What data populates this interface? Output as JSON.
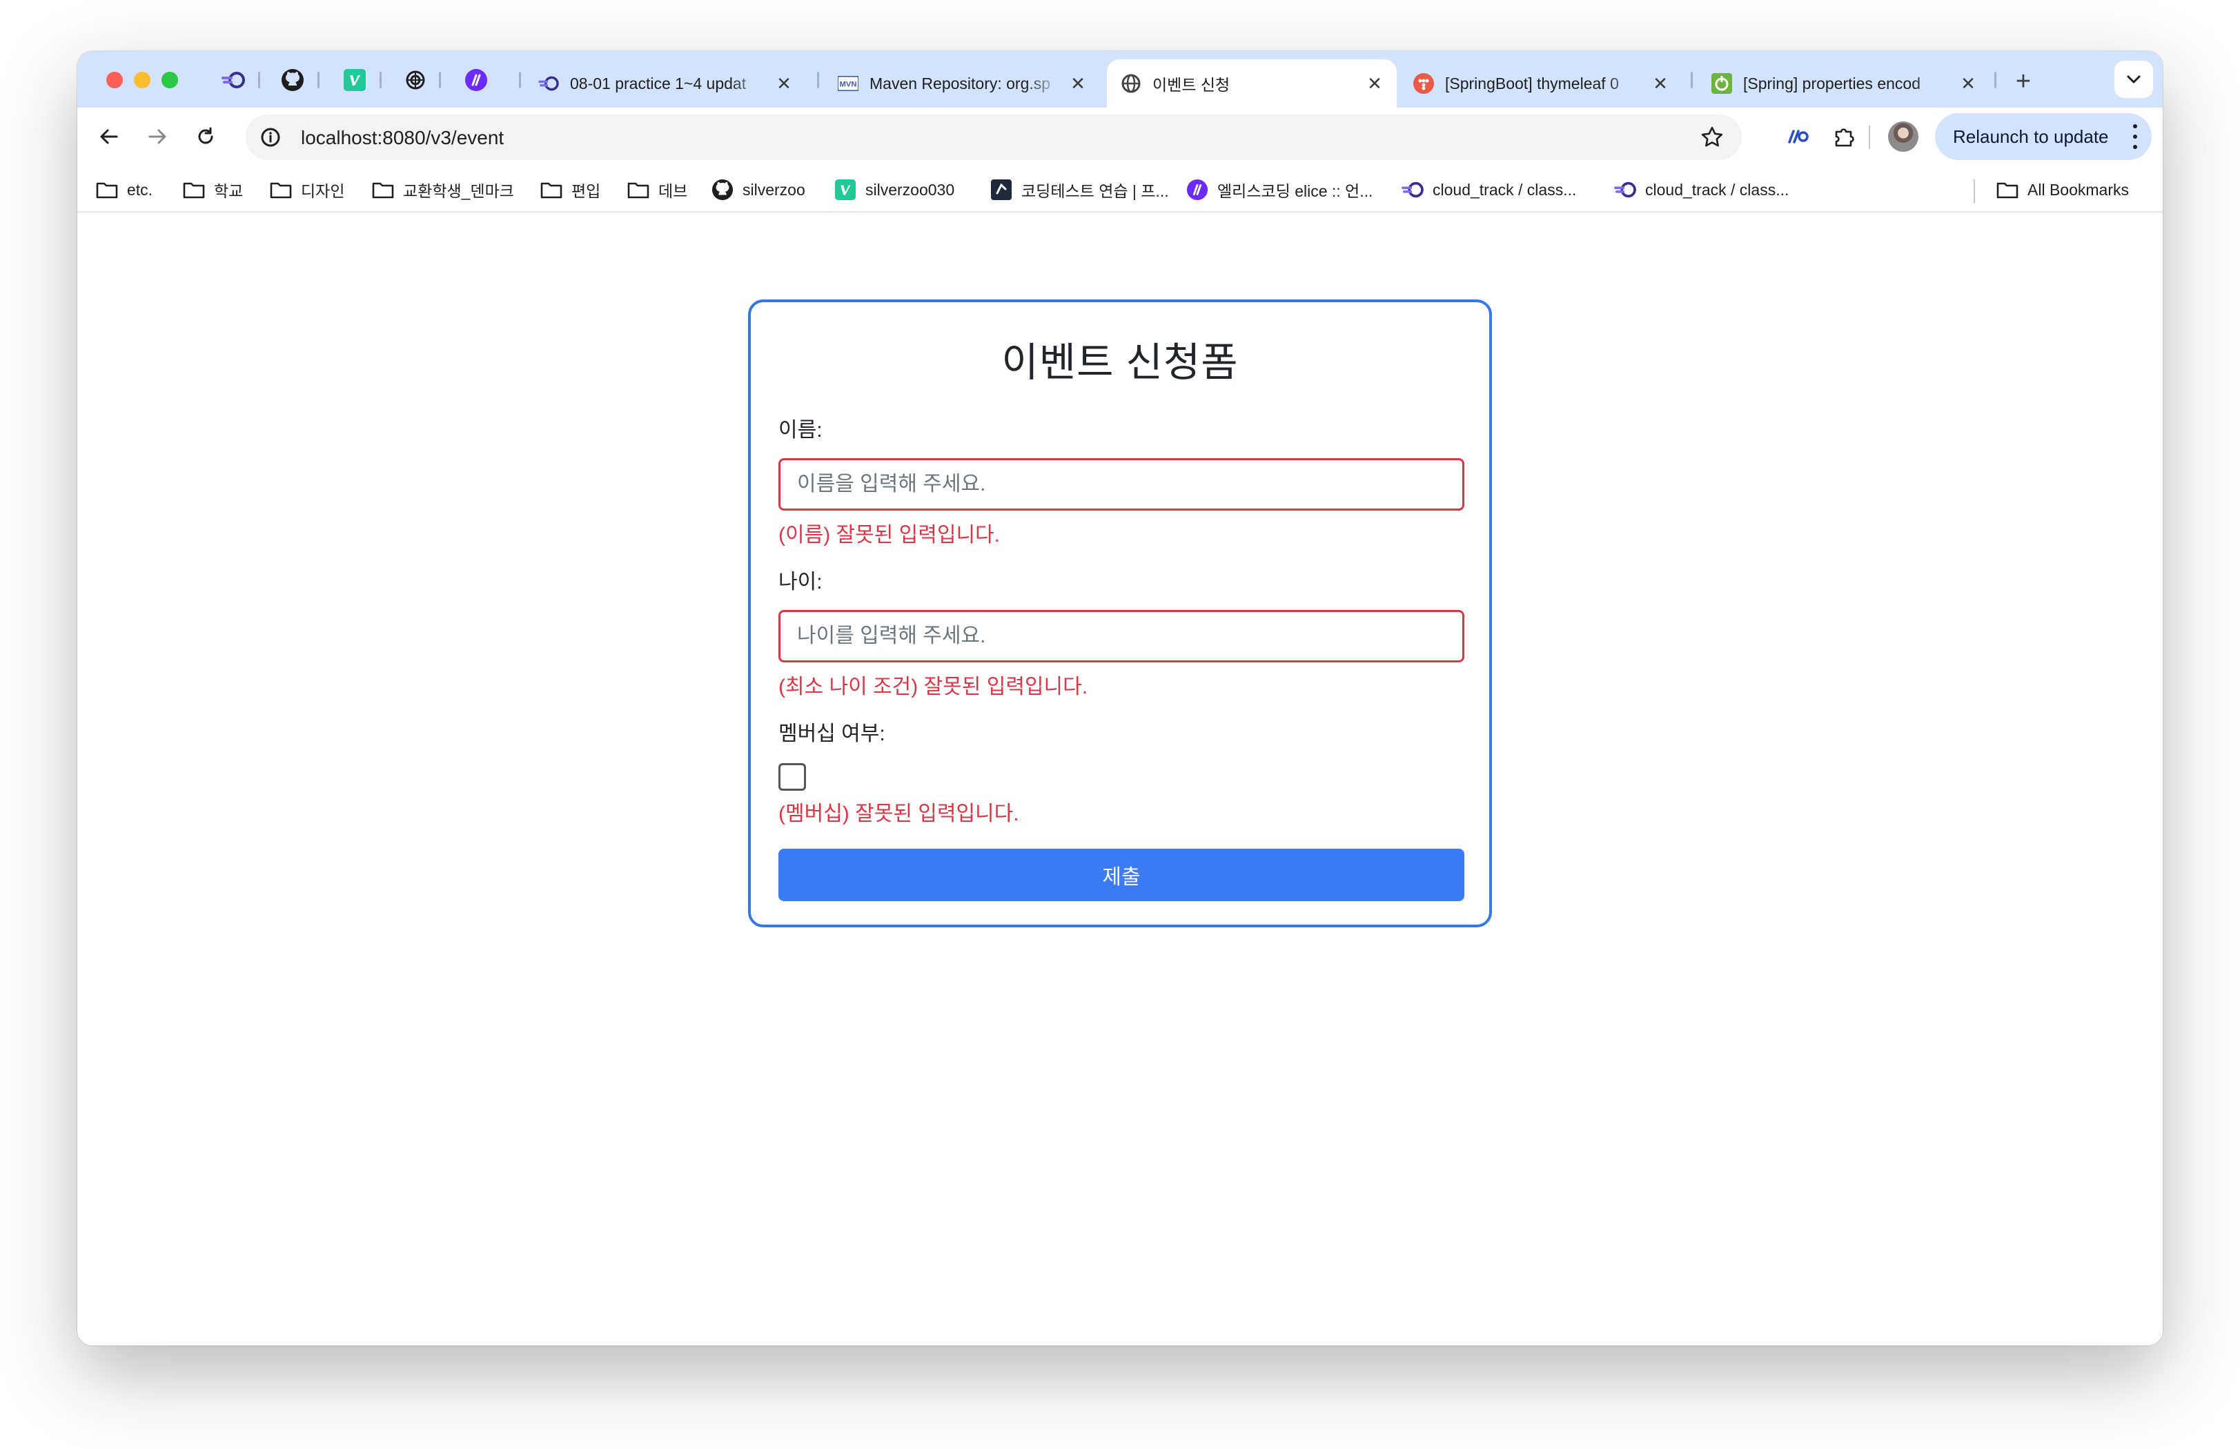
{
  "browser": {
    "colors": {
      "tabstrip": "#d3e3fd",
      "accent": "#3577ea",
      "error": "#dc3545",
      "button": "#3b7bf6"
    },
    "pinned_tabs": [
      "railway-icon",
      "github-icon",
      "velog-icon",
      "chatgpt-icon",
      "elice-icon"
    ],
    "tabs": [
      {
        "title": "08-01 practice 1~4 updat",
        "icon": "railway-icon"
      },
      {
        "title": "Maven Repository: org.sp",
        "icon": "maven-icon"
      },
      {
        "title": "이벤트 신청",
        "icon": "globe-icon",
        "active": true
      },
      {
        "title": "[SpringBoot] thymeleaf 0",
        "icon": "tistory-icon"
      },
      {
        "title": "[Spring] properties encod",
        "icon": "spring-icon"
      }
    ],
    "url": "localhost:8080/v3/event",
    "relaunch_label": "Relaunch to update",
    "bookmarks": [
      {
        "label": "etc.",
        "icon": "folder-icon"
      },
      {
        "label": "학교",
        "icon": "folder-icon"
      },
      {
        "label": "디자인",
        "icon": "folder-icon"
      },
      {
        "label": "교환학생_덴마크",
        "icon": "folder-icon"
      },
      {
        "label": "편입",
        "icon": "folder-icon"
      },
      {
        "label": "데브",
        "icon": "folder-icon"
      },
      {
        "label": "silverzoo",
        "icon": "github-icon"
      },
      {
        "label": "silverzoo030",
        "icon": "velog-icon"
      },
      {
        "label": "코딩테스트 연습 | 프...",
        "icon": "programmers-icon"
      },
      {
        "label": "엘리스코딩 elice :: 언...",
        "icon": "elice-icon"
      },
      {
        "label": "cloud_track / class...",
        "icon": "railway-icon"
      },
      {
        "label": "cloud_track / class...",
        "icon": "railway-icon"
      }
    ],
    "all_bookmarks": "All Bookmarks"
  },
  "form": {
    "title": "이벤트 신청폼",
    "name": {
      "label": "이름:",
      "placeholder": "이름을 입력해 주세요.",
      "value": "",
      "error": "(이름) 잘못된 입력입니다."
    },
    "age": {
      "label": "나이:",
      "placeholder": "나이를 입력해 주세요.",
      "value": "",
      "error": "(최소 나이 조건) 잘못된 입력입니다."
    },
    "membership": {
      "label": "멤버십 여부:",
      "checked": false,
      "error": "(멤버십) 잘못된 입력입니다."
    },
    "submit_label": "제출"
  }
}
